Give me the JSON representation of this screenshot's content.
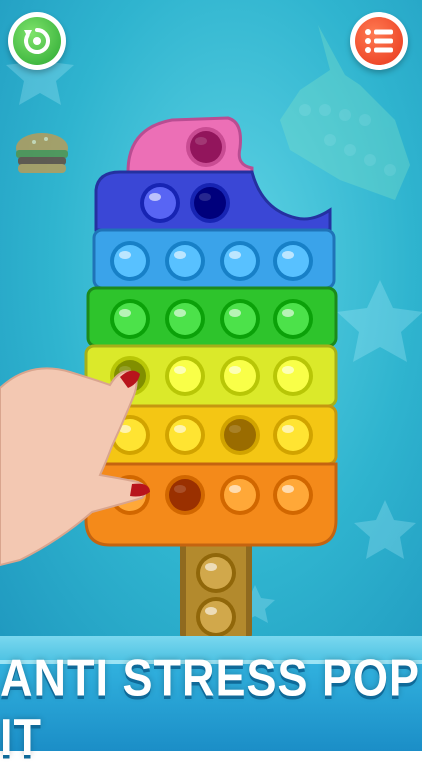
{
  "game": {
    "banner_title": "ANTI STRESS POP IT"
  },
  "buttons": {
    "restart": {
      "icon": "restart-icon",
      "color": "#2aa832"
    },
    "menu": {
      "icon": "menu-list-icon",
      "color": "#e8361b"
    }
  },
  "toy": {
    "shape": "ice-pop",
    "rows": [
      {
        "color": "#ec6fb6",
        "bubbles": 1,
        "popped": [
          0
        ]
      },
      {
        "color": "#3a47d6",
        "bubbles": 2,
        "popped": [
          1
        ]
      },
      {
        "color": "#3aa3ea",
        "bubbles": 4,
        "popped": []
      },
      {
        "color": "#2ec42c",
        "bubbles": 4,
        "popped": []
      },
      {
        "color": "#dbe92a",
        "bubbles": 4,
        "popped": [
          0
        ]
      },
      {
        "color": "#f4c614",
        "bubbles": 4,
        "popped": [
          2
        ]
      },
      {
        "color": "#f48a1a",
        "bubbles": 4,
        "popped": [
          1
        ]
      }
    ],
    "stick": {
      "color": "#b38a2d",
      "bubbles": 2
    }
  }
}
